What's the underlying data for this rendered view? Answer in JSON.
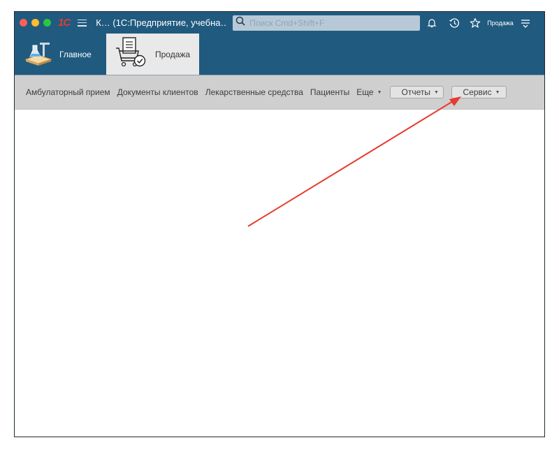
{
  "titlebar": {
    "logo_text": "1С",
    "title": "К… (1С:Предприятие, учебна…",
    "search_placeholder": "Поиск Cmd+Shift+F",
    "user": "Продажа"
  },
  "sections": [
    {
      "label": "Главное",
      "icon": "flask-scale-icon"
    },
    {
      "label": "Продажа",
      "icon": "cart-document-icon",
      "selected": true
    }
  ],
  "commands": {
    "items": [
      "Амбулаторный прием",
      "Документы клиентов",
      "Лекарственные средства",
      "Пациенты"
    ],
    "more": "Еще",
    "reports": "Отчеты",
    "service": "Сервис"
  },
  "colors": {
    "header_bg": "#205a7f",
    "command_bar_bg": "#cfcfcf",
    "selected_section_bg": "#e9e9e9",
    "annotation_arrow": "#e63b2e"
  }
}
